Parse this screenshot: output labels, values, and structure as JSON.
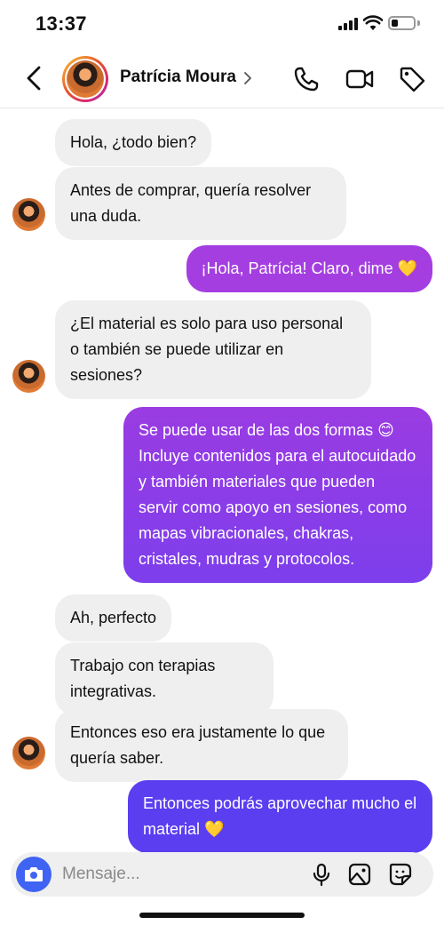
{
  "status_bar": {
    "time": "13:37"
  },
  "header": {
    "contact_name": "Patrícia Moura",
    "icons": [
      "back-icon",
      "phone-icon",
      "video-icon",
      "tag-icon"
    ]
  },
  "messages": [
    {
      "direction": "incoming",
      "text": "Hola, ¿todo bien?"
    },
    {
      "direction": "incoming",
      "text": "Antes de comprar, quería resolver una duda."
    },
    {
      "direction": "outgoing",
      "text": "¡Hola, Patrícia! Claro, dime 💛"
    },
    {
      "direction": "incoming",
      "text": "¿El material es solo para uso personal o también se puede utilizar en sesiones?"
    },
    {
      "direction": "outgoing",
      "text": "Se puede usar de las dos formas 😊 Incluye contenidos para el autocuidado y también materiales que pueden servir como apoyo en sesiones, como mapas vibracionales, chakras, cristales, mudras y protocolos."
    },
    {
      "direction": "incoming",
      "text": "Ah, perfecto"
    },
    {
      "direction": "incoming",
      "text": "Trabajo con terapias integrativas."
    },
    {
      "direction": "incoming",
      "text": "Entonces eso era justamente lo que quería saber."
    },
    {
      "direction": "outgoing",
      "text": "Entonces podrás aprovechar mucho el material 💛"
    }
  ],
  "composer": {
    "placeholder": "Mensaje...",
    "icons": [
      "camera-icon",
      "microphone-icon",
      "gallery-icon",
      "sticker-icon"
    ]
  },
  "colors": {
    "outgoing_top": "#a43ee0",
    "outgoing_bottom": "#5b3ef0",
    "incoming_bg": "#efefef",
    "camera_button": "#3f63f2"
  }
}
